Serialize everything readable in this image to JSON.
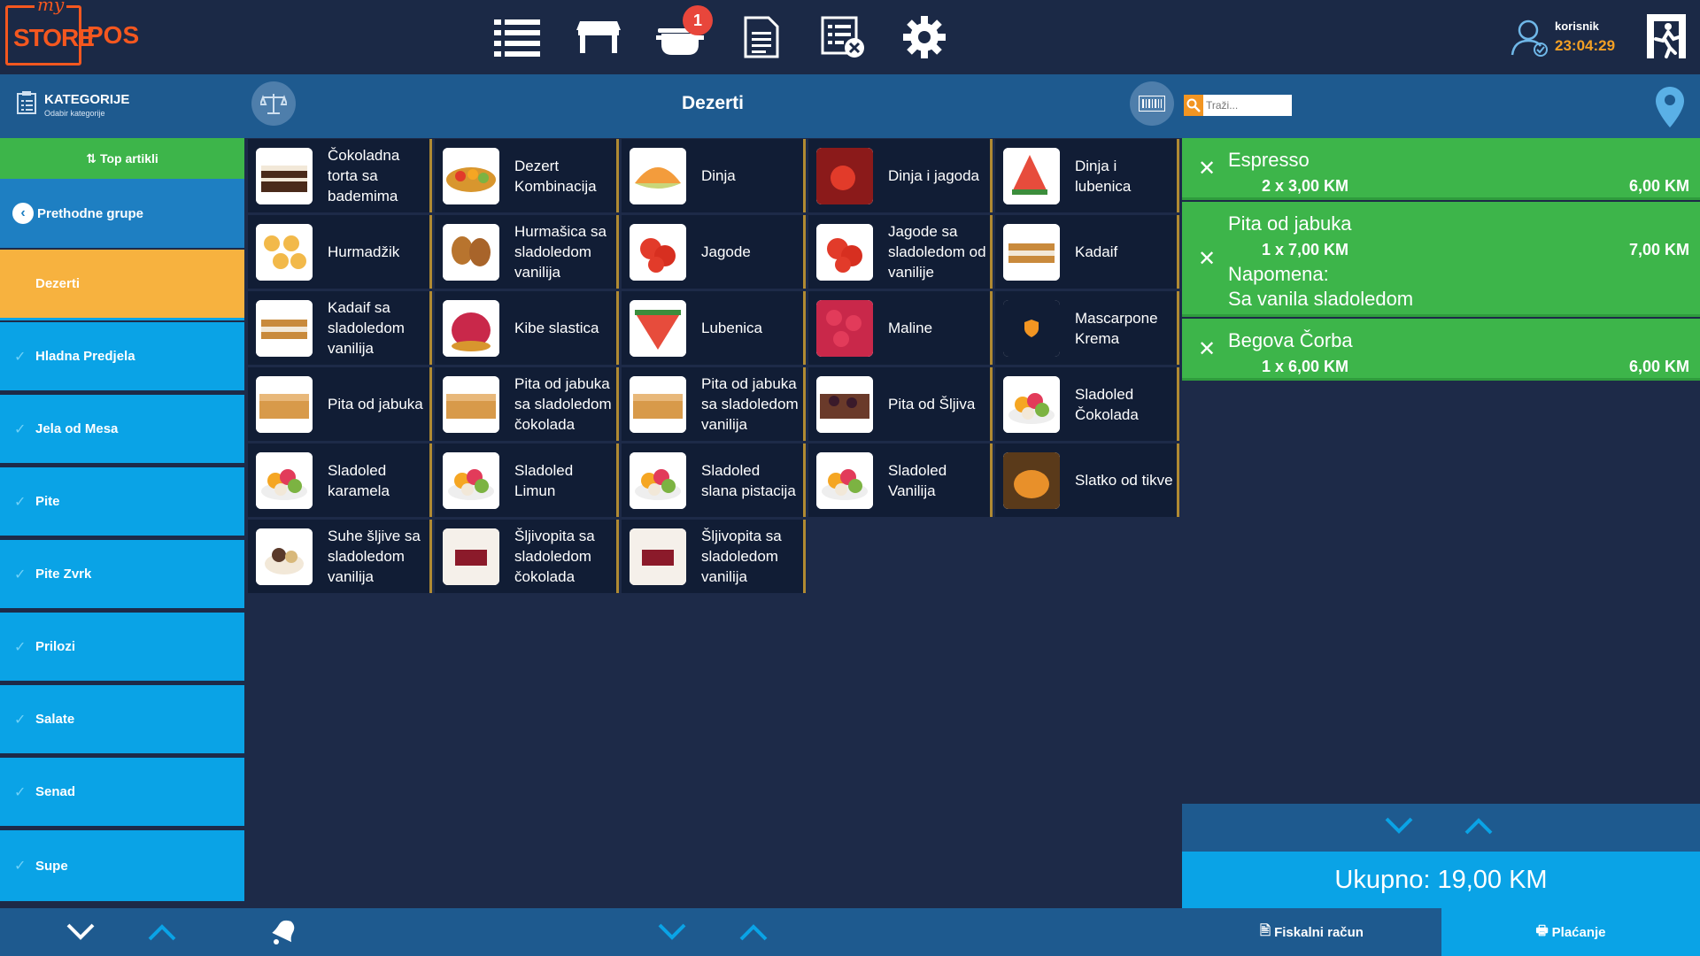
{
  "app": {
    "logo_my": "my",
    "logo_store": "STORE",
    "logo_pos": "POS"
  },
  "header": {
    "nav_icons": [
      "list-icon",
      "table-icon",
      "pot-icon",
      "document-icon",
      "cancel-list-icon",
      "gear-icon"
    ],
    "order_badge": "1",
    "user_name": "korisnik",
    "time": "23:04:29"
  },
  "subheader": {
    "categories_title": "KATEGORIJE",
    "categories_subtitle": "Odabir kategorije",
    "current_category": "Dezerti",
    "search_placeholder": "Traži..."
  },
  "sidebar": {
    "top_articles": "Top artikli",
    "previous_groups": "Prethodne grupe",
    "items": [
      "Dezerti",
      "Hladna Predjela",
      "Jela od Mesa",
      "Pite",
      "Pite Zvrk",
      "Prilozi",
      "Salate",
      "Senad",
      "Supe"
    ]
  },
  "products": [
    {
      "name": "Čokoladna torta sa bademima",
      "img": "cake"
    },
    {
      "name": "Dezert Kombinacija",
      "img": "tart"
    },
    {
      "name": "Dinja",
      "img": "melon"
    },
    {
      "name": "Dinja i jagoda",
      "img": "strawberry-melon"
    },
    {
      "name": "Dinja i lubenica",
      "img": "watermelon-melon"
    },
    {
      "name": "Hurmadžik",
      "img": "cookies"
    },
    {
      "name": "Hurmašica sa sladoledom vanilija",
      "img": "pastry"
    },
    {
      "name": "Jagode",
      "img": "strawberry"
    },
    {
      "name": "Jagode sa sladoledom od vanilije",
      "img": "strawberry"
    },
    {
      "name": "Kadaif",
      "img": "kadaif"
    },
    {
      "name": "Kadaif sa sladoledom vanilija",
      "img": "kadaif"
    },
    {
      "name": "Kibe slastica",
      "img": "raspberry-tart"
    },
    {
      "name": "Lubenica",
      "img": "watermelon"
    },
    {
      "name": "Maline",
      "img": "raspberries"
    },
    {
      "name": "Mascarpone Krema",
      "img": "shield"
    },
    {
      "name": "Pita od jabuka",
      "img": "pie"
    },
    {
      "name": "Pita od jabuka sa sladoledom čokolada",
      "img": "pie"
    },
    {
      "name": "Pita od jabuka sa sladoledom vanilija",
      "img": "pie"
    },
    {
      "name": "Pita od Šljiva",
      "img": "plum-pie"
    },
    {
      "name": "Sladoled Čokolada",
      "img": "icecream"
    },
    {
      "name": "Sladoled karamela",
      "img": "icecream"
    },
    {
      "name": "Sladoled Limun",
      "img": "icecream"
    },
    {
      "name": "Sladoled slana pistacija",
      "img": "icecream"
    },
    {
      "name": "Sladoled Vanilija",
      "img": "icecream"
    },
    {
      "name": "Slatko od tikve",
      "img": "pumpkin"
    },
    {
      "name": "Suhe šljive sa sladoledom vanilija",
      "img": "prunes"
    },
    {
      "name": "Šljivopita sa sladoledom čokolada",
      "img": "plum-cake"
    },
    {
      "name": "Šljivopita sa sladoledom vanilija",
      "img": "plum-cake"
    }
  ],
  "order": {
    "items": [
      {
        "name": "Espresso",
        "qty": "2 x 3,00 KM",
        "price": "6,00 KM"
      },
      {
        "name": "Pita od jabuka",
        "qty": "1 x 7,00 KM",
        "price": "7,00 KM",
        "note_label": "Napomena:",
        "note": "Sa vanila sladoledom"
      },
      {
        "name": "Begova Čorba",
        "qty": "1 x 6,00 KM",
        "price": "6,00 KM"
      }
    ],
    "total": "Ukupno: 19,00 KM"
  },
  "footer": {
    "fiscal": "Fiskalni račun",
    "payment": "Plaćanje"
  },
  "colors": {
    "accent": "#f4571f",
    "sidebar": "#0aa3e6",
    "active": "#f7b23f",
    "green": "#3db54a",
    "bar": "#1e5a8f"
  }
}
